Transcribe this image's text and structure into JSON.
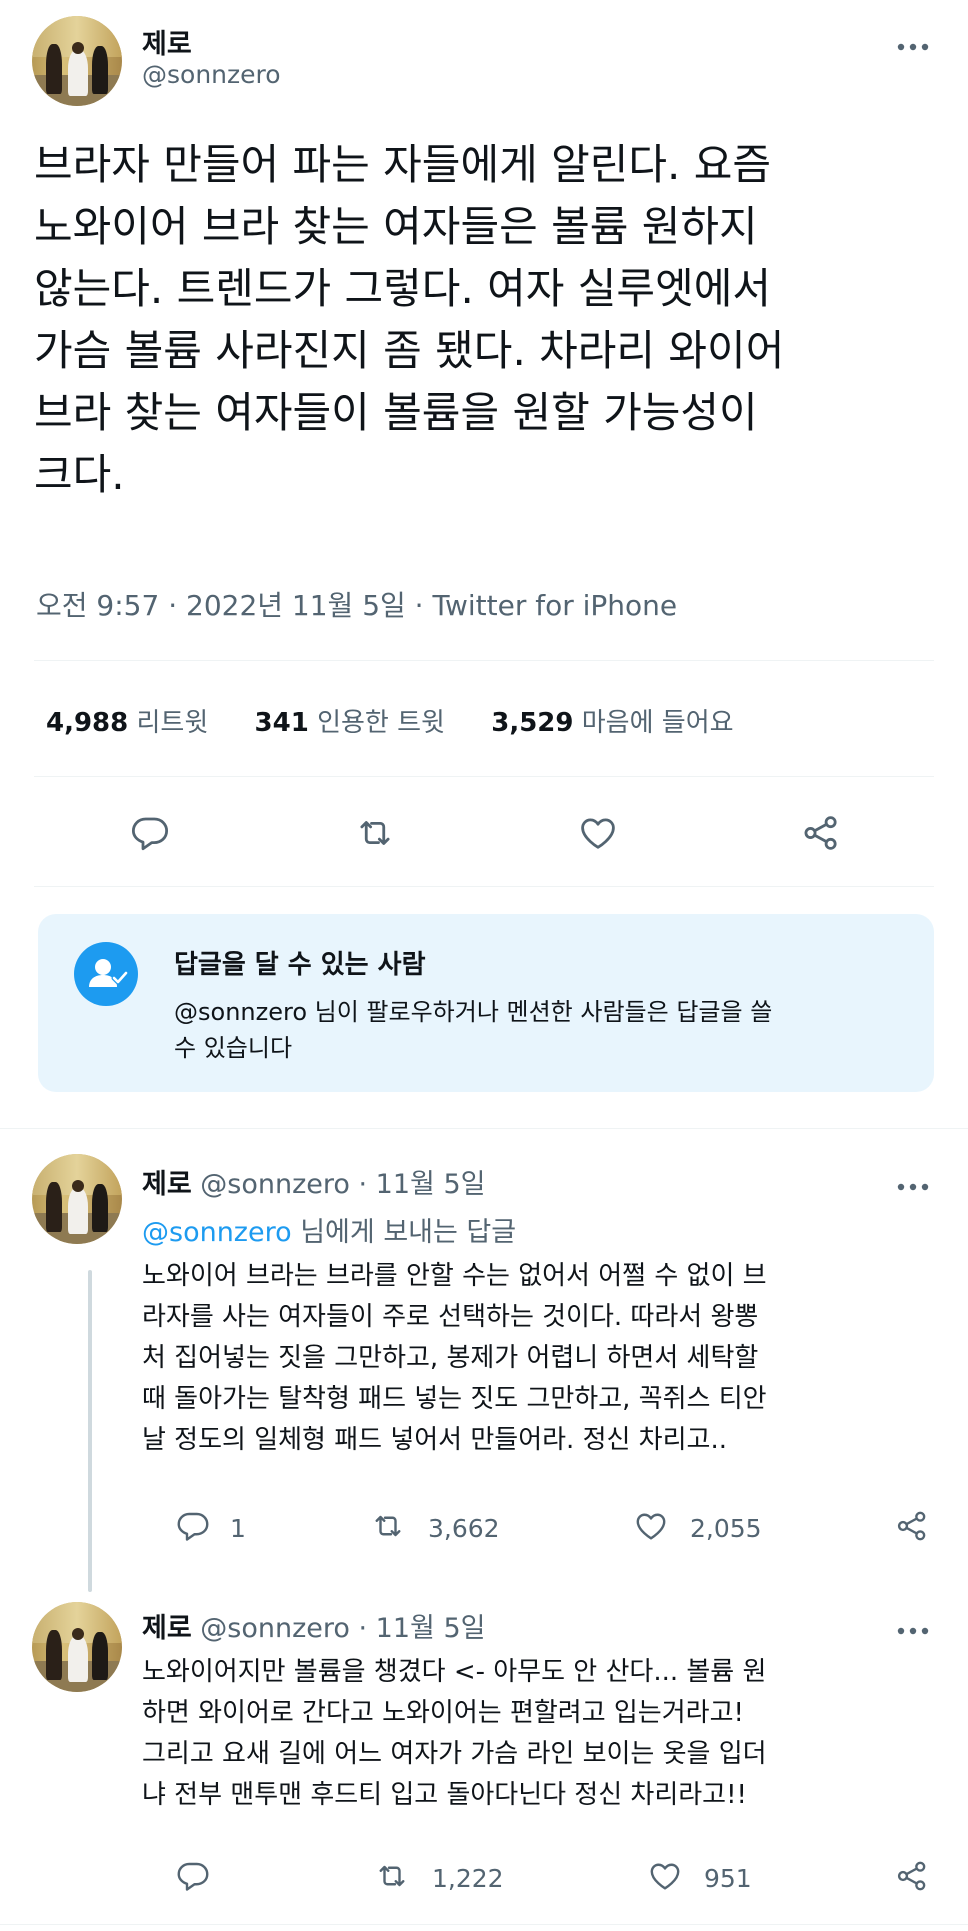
{
  "main_tweet": {
    "display_name": "제로",
    "handle": "@sonnzero",
    "text_lines": [
      "브라자 만들어 파는 자들에게 알린다. 요즘",
      "노와이어 브라 찾는 여자들은 볼륨 원하지",
      "않는다. 트렌드가 그렇다. 여자 실루엣에서",
      "가슴 볼륨 사라진지 좀 됐다. 차라리 와이어",
      "브라 찾는 여자들이 볼륨을 원할 가능성이",
      "크다."
    ],
    "meta": "오전 9:57 · 2022년 11월 5일 · Twitter for iPhone",
    "stats": {
      "retweets": "4,988",
      "retweets_label": "리트윗",
      "quotes": "341",
      "quotes_label": "인용한 트윗",
      "likes": "3,529",
      "likes_label": "마음에 들어요"
    }
  },
  "reply_notice": {
    "title": "답글을 달 수 있는 사람",
    "line1": "@sonnzero 님이 팔로우하거나 멘션한 사람들은 답글을 쓸",
    "line2": "수 있습니다"
  },
  "replies": [
    {
      "display_name": "제로",
      "handle": "@sonnzero",
      "date": "· 11월 5일",
      "replying_to_handle": "@sonnzero",
      "replying_to_suffix": "님에게 보내는 답글",
      "text_lines": [
        "노와이어 브라는 브라를 안할 수는 없어서 어쩔 수 없이 브",
        "라자를 사는 여자들이 주로 선택하는 것이다. 따라서 왕뽕",
        "처 집어넣는 짓을 그만하고, 봉제가 어렵니 하면서 세탁할",
        "때 돌아가는 탈착형 패드 넣는 짓도 그만하고, 꼭쥐스 티안",
        "날 정도의 일체형 패드 넣어서 만들어라. 정신 차리고.."
      ],
      "reply_count": "1",
      "retweet_count": "3,662",
      "like_count": "2,055"
    },
    {
      "display_name": "제로",
      "handle": "@sonnzero",
      "date": "· 11월 5일",
      "text_lines": [
        "노와이어지만 볼륨을 챙겼다 <- 아무도 안 산다... 볼륨 원",
        "하면 와이어로 간다고 노와이어는 편할려고 입는거라고!",
        "그리고 요새 길에 어느 여자가 가슴 라인 보이는 옷을 입더",
        "냐 전부 맨투맨 후드티 입고 돌아다닌다 정신 차리라고!!"
      ],
      "reply_count": "",
      "retweet_count": "1,222",
      "like_count": "951"
    }
  ],
  "icons": {
    "more": "more-dots-icon",
    "reply": "reply-bubble-icon",
    "retweet": "retweet-icon",
    "like": "heart-icon",
    "share": "share-icon",
    "notice": "person-check-icon"
  },
  "colors": {
    "accent": "#1d9bf0",
    "notice_bg": "#e8f5fd",
    "secondary_text": "#536471",
    "divider": "#eff3f4"
  }
}
